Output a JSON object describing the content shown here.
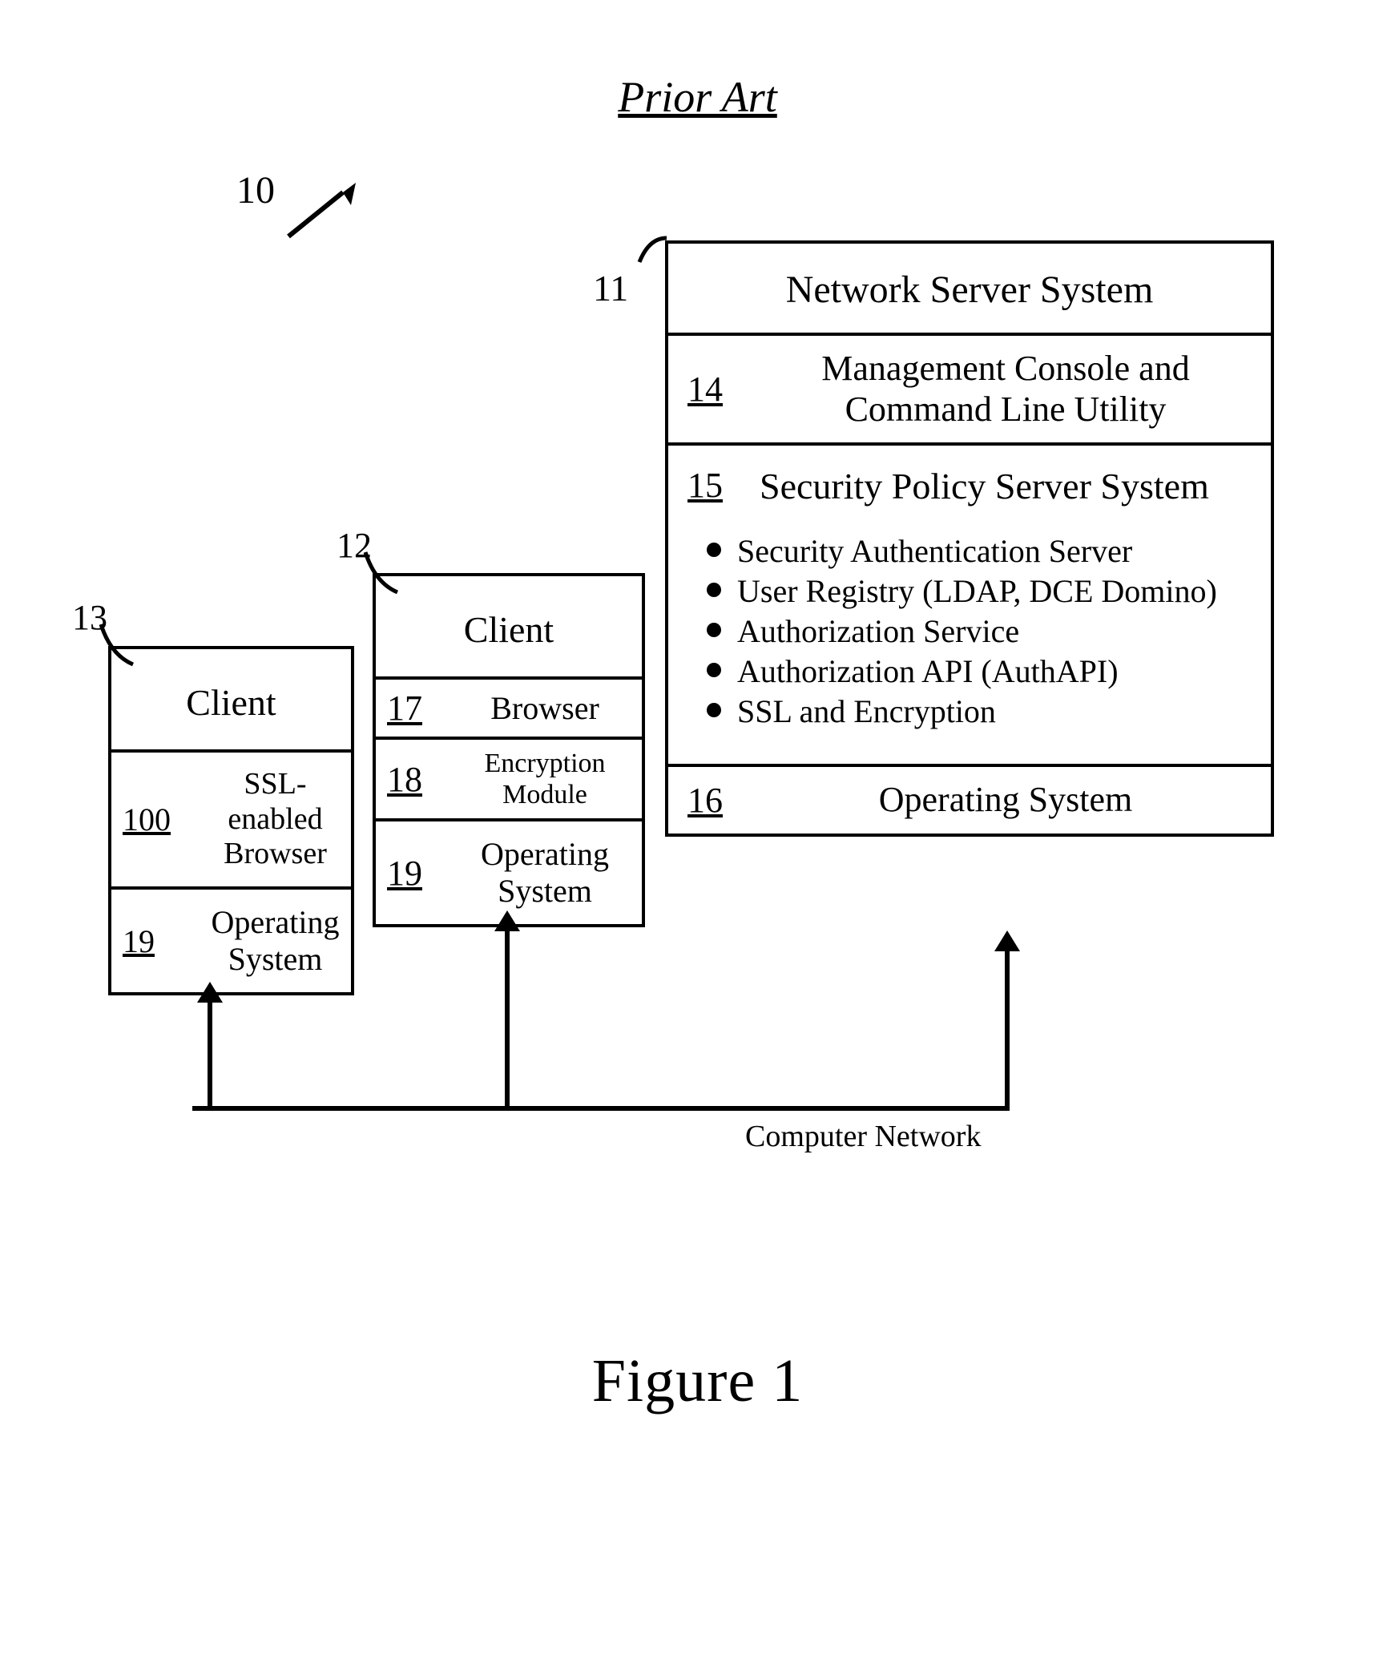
{
  "title_prior_art": "Prior Art",
  "ref_main": "10",
  "server": {
    "callout_ref": "11",
    "title": "Network Server System",
    "row_mgmt": {
      "ref": "14",
      "label": "Management Console and\nCommand Line Utility"
    },
    "security": {
      "ref": "15",
      "title": "Security Policy  Server System",
      "bullets": [
        "Security Authentication Server",
        "User Registry (LDAP, DCE Domino)",
        "Authorization Service",
        "Authorization API (AuthAPI)",
        "SSL and Encryption"
      ]
    },
    "row_os": {
      "ref": "16",
      "label": "Operating System"
    }
  },
  "client12": {
    "callout_ref": "12",
    "title": "Client",
    "row_browser": {
      "ref": "17",
      "label": "Browser"
    },
    "row_enc": {
      "ref": "18",
      "label": "Encryption Module"
    },
    "row_os": {
      "ref": "19",
      "label": "Operating\nSystem"
    }
  },
  "client13": {
    "callout_ref": "13",
    "title": "Client",
    "row_ssl": {
      "ref": "100",
      "label": "SSL-enabled\nBrowser"
    },
    "row_os": {
      "ref": "19",
      "label": "Operating\nSystem"
    }
  },
  "bus_label": "Computer Network",
  "figure_label": "Figure 1"
}
